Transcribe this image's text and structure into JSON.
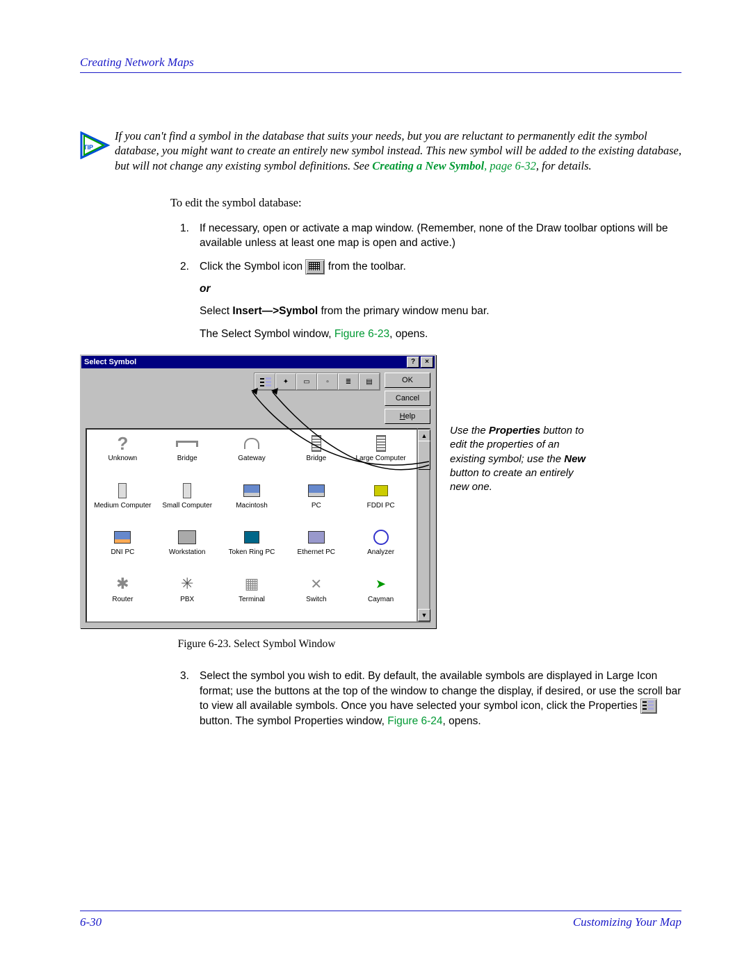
{
  "header": {
    "title": "Creating Network Maps"
  },
  "tip": {
    "badge": "TIP",
    "text_before": "If you can't find a symbol in the database that suits your needs, but you are reluctant to permanently edit the symbol database, you might want to create an entirely new symbol instead. This new symbol will be added to the existing database, but will not change any existing symbol definitions. See ",
    "link": "Creating a New Symbol",
    "page_ref": ", page 6-32",
    "after": ", for details."
  },
  "intro": "To edit the symbol database:",
  "steps": {
    "s1": "If necessary, open or activate a map window. (Remember, none of the Draw toolbar options will be available unless at least one map is open and active.)",
    "s2a": "Click the Symbol icon ",
    "s2b": " from the toolbar.",
    "or": "or",
    "s2c_a": "Select ",
    "s2c_b": "Insert—>Symbol",
    "s2c_c": " from the primary window menu bar.",
    "s2d_a": "The Select Symbol window, ",
    "s2d_ref": "Figure 6-23",
    "s2d_b": ", opens.",
    "s3_a": "Select the symbol you wish to edit. By default, the available symbols are displayed in Large Icon format; use the buttons at the top of the window to change the display, if desired, or use the scroll bar to view all available symbols. Once you have selected your symbol icon, click the Properties ",
    "s3_b": " button. The symbol Properties window, ",
    "s3_ref": "Figure 6-24",
    "s3_c": ", opens."
  },
  "window": {
    "title": "Select Symbol",
    "buttons": {
      "ok": "OK",
      "cancel": "Cancel",
      "help": "Help"
    },
    "help_key": "H",
    "symbols": [
      {
        "label": "Unknown",
        "g": "g-q"
      },
      {
        "label": "Bridge",
        "g": "g-bridge"
      },
      {
        "label": "Gateway",
        "g": "g-gateway"
      },
      {
        "label": "Bridge",
        "g": "g-tower"
      },
      {
        "label": "Large Computer",
        "g": "g-tower"
      },
      {
        "label": "Medium Computer",
        "g": "g-box"
      },
      {
        "label": "Small Computer",
        "g": "g-box"
      },
      {
        "label": "Macintosh",
        "g": "g-mon"
      },
      {
        "label": "PC",
        "g": "g-mon"
      },
      {
        "label": "FDDI PC",
        "g": "g-fddi"
      },
      {
        "label": "DNI PC",
        "g": "g-dni"
      },
      {
        "label": "Workstation",
        "g": "g-ws"
      },
      {
        "label": "Token Ring PC",
        "g": "g-tr"
      },
      {
        "label": "Ethernet PC",
        "g": "g-eth"
      },
      {
        "label": "Analyzer",
        "g": "g-an"
      },
      {
        "label": "Router",
        "g": "g-router"
      },
      {
        "label": "PBX",
        "g": "g-pbx"
      },
      {
        "label": "Terminal",
        "g": "g-term"
      },
      {
        "label": "Switch",
        "g": "g-sw"
      },
      {
        "label": "Cayman",
        "g": "g-cay"
      }
    ]
  },
  "caption": "Figure 6-23.  Select Symbol Window",
  "sidenote": {
    "a": "Use the ",
    "b": "Properties",
    "c": " button to edit the properties of an existing symbol; use the ",
    "d": "New",
    "e": " button to create an entirely new one."
  },
  "footer": {
    "page": "6-30",
    "section": "Customizing Your Map"
  }
}
